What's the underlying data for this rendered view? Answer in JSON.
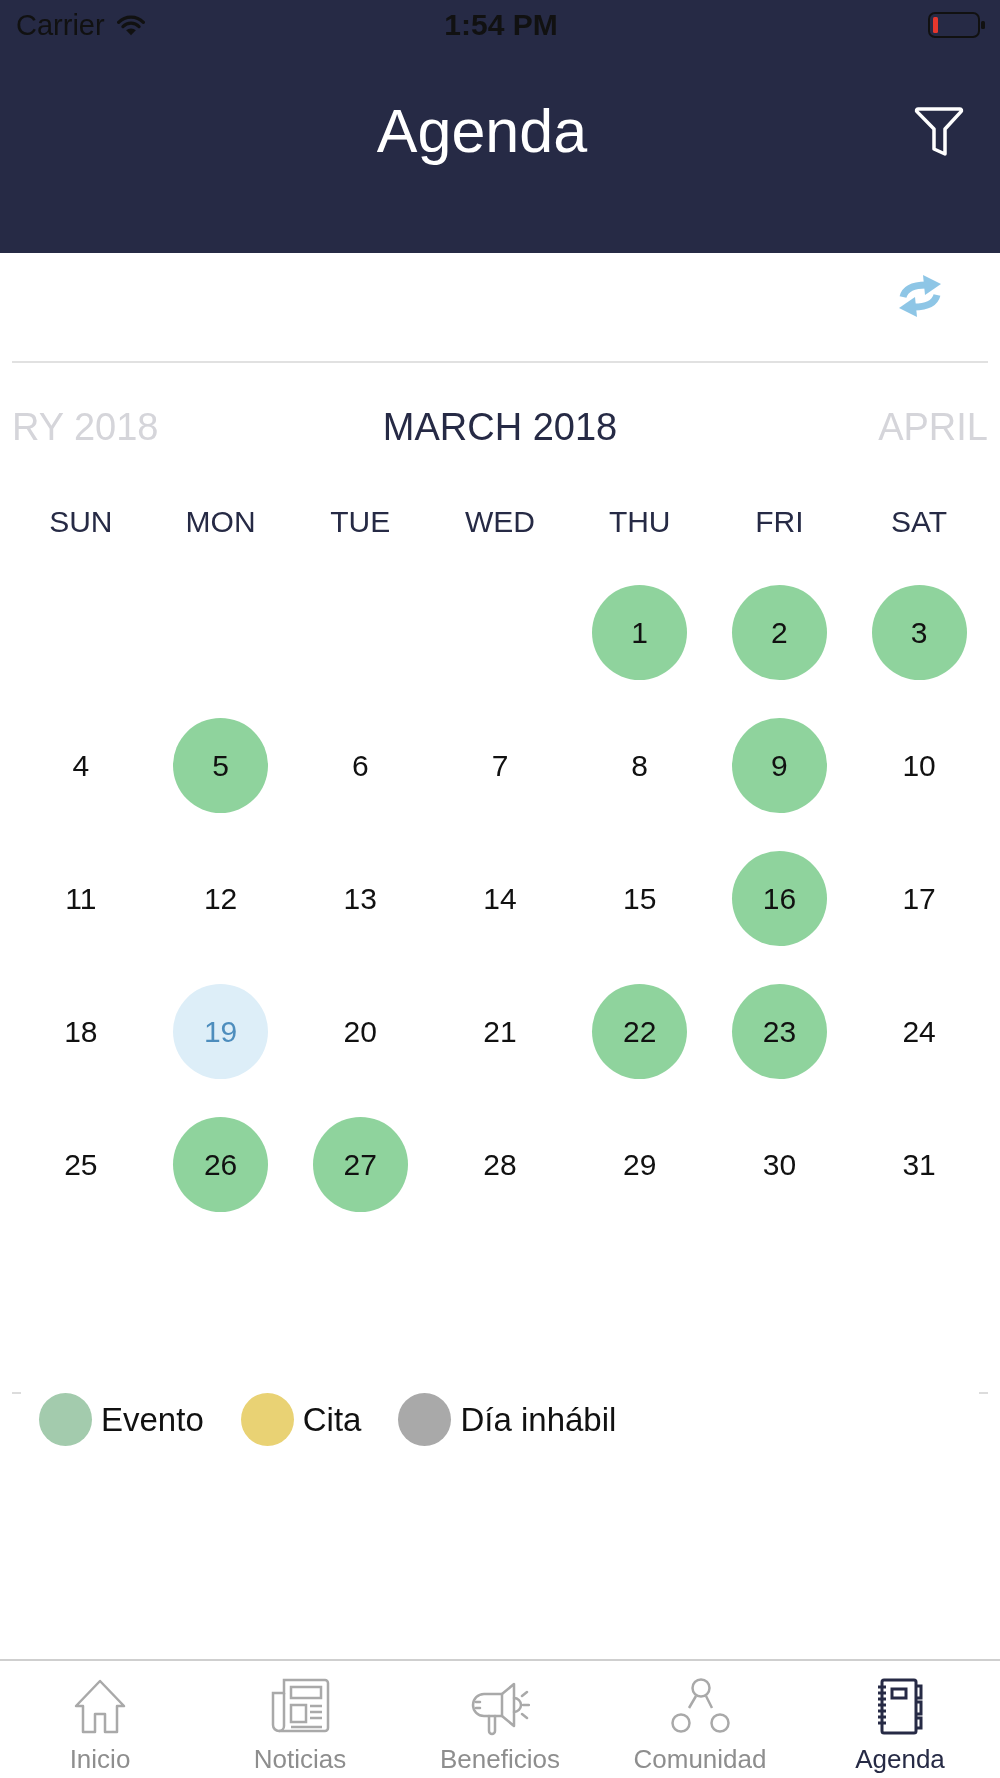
{
  "status_bar": {
    "carrier": "Carrier",
    "time": "1:54 PM"
  },
  "header": {
    "title": "Agenda"
  },
  "calendar": {
    "months": [
      {
        "label": "RY 2018",
        "selected": false
      },
      {
        "label": "MARCH 2018",
        "selected": true
      },
      {
        "label": "APRIL",
        "selected": false
      }
    ],
    "weekdays": [
      "SUN",
      "MON",
      "TUE",
      "WED",
      "THU",
      "FRI",
      "SAT"
    ],
    "weeks": [
      [
        {
          "day": "1",
          "kind": "event"
        },
        {
          "day": "2",
          "kind": "event"
        },
        {
          "day": "3",
          "kind": "event"
        }
      ],
      [
        {
          "day": "4",
          "kind": "plain"
        },
        {
          "day": "5",
          "kind": "event"
        },
        {
          "day": "6",
          "kind": "plain"
        },
        {
          "day": "7",
          "kind": "plain"
        },
        {
          "day": "8",
          "kind": "plain"
        },
        {
          "day": "9",
          "kind": "event"
        },
        {
          "day": "10",
          "kind": "plain"
        }
      ],
      [
        {
          "day": "11",
          "kind": "plain"
        },
        {
          "day": "12",
          "kind": "plain"
        },
        {
          "day": "13",
          "kind": "plain"
        },
        {
          "day": "14",
          "kind": "plain"
        },
        {
          "day": "15",
          "kind": "plain"
        },
        {
          "day": "16",
          "kind": "event"
        },
        {
          "day": "17",
          "kind": "plain"
        }
      ],
      [
        {
          "day": "18",
          "kind": "plain"
        },
        {
          "day": "19",
          "kind": "today"
        },
        {
          "day": "20",
          "kind": "plain"
        },
        {
          "day": "21",
          "kind": "plain"
        },
        {
          "day": "22",
          "kind": "event"
        },
        {
          "day": "23",
          "kind": "event"
        },
        {
          "day": "24",
          "kind": "plain"
        }
      ],
      [
        {
          "day": "25",
          "kind": "plain"
        },
        {
          "day": "26",
          "kind": "event"
        },
        {
          "day": "27",
          "kind": "event"
        },
        {
          "day": "28",
          "kind": "plain"
        },
        {
          "day": "29",
          "kind": "plain"
        },
        {
          "day": "30",
          "kind": "plain"
        },
        {
          "day": "31",
          "kind": "plain"
        }
      ]
    ]
  },
  "legend": [
    {
      "label": "Evento",
      "color": "#a3cbad"
    },
    {
      "label": "Cita",
      "color": "#e9d274"
    },
    {
      "label": "Día inhábil",
      "color": "#a9a9a9"
    }
  ],
  "tab_bar": [
    {
      "label": "Inicio",
      "selected": false
    },
    {
      "label": "Noticias",
      "selected": false
    },
    {
      "label": "Beneficios",
      "selected": false
    },
    {
      "label": "Comunidad",
      "selected": false
    },
    {
      "label": "Agenda",
      "selected": true
    }
  ]
}
